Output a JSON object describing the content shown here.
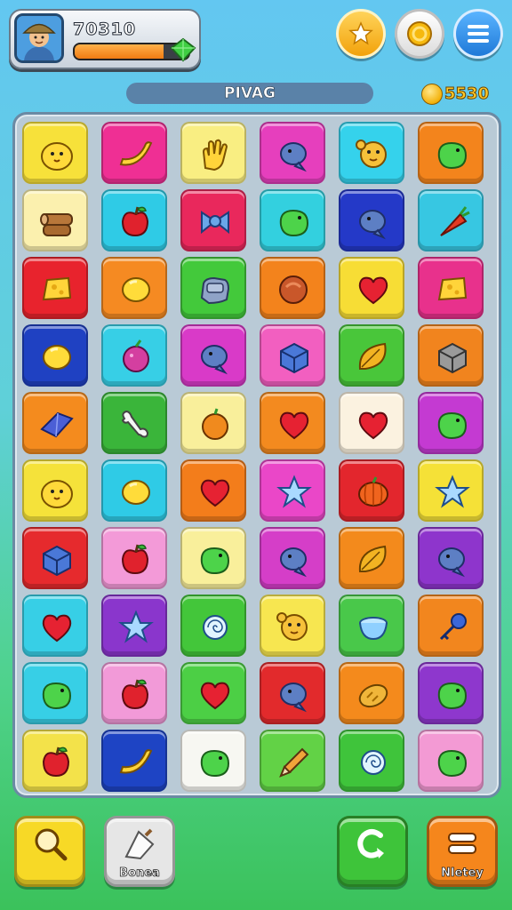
{
  "player": {
    "score": "70310",
    "xp_progress": 0.78,
    "avatar_icon": "explorer-avatar-icon",
    "gem_icon": "green-gem-icon"
  },
  "header_buttons": [
    {
      "name": "star-icon",
      "color": "#f6b51d"
    },
    {
      "name": "coin-icon",
      "color": "#f5f5f5"
    },
    {
      "name": "menu-icon",
      "color": "#2a8ee6"
    }
  ],
  "level": {
    "title": "PIVAG"
  },
  "coins": {
    "amount": "5530"
  },
  "grid": [
    [
      {
        "color": "#f7e13a",
        "icon": "chick"
      },
      {
        "color": "#ef2f94",
        "icon": "banana"
      },
      {
        "color": "#f9ee82",
        "icon": "glove"
      },
      {
        "color": "#e63fbd",
        "icon": "fish"
      },
      {
        "color": "#35d2ec",
        "icon": "flower"
      },
      {
        "color": "#f3841c",
        "icon": "blob"
      }
    ],
    [
      {
        "color": "#fbf0ae",
        "icon": "log"
      },
      {
        "color": "#2fcbe6",
        "icon": "apple"
      },
      {
        "color": "#e9285c",
        "icon": "bow"
      },
      {
        "color": "#33d0df",
        "icon": "blob"
      },
      {
        "color": "#2439c8",
        "icon": "fish"
      },
      {
        "color": "#37c7e2",
        "icon": "carrot"
      }
    ],
    [
      {
        "color": "#e8232d",
        "icon": "cheese"
      },
      {
        "color": "#f58a22",
        "icon": "lemon"
      },
      {
        "color": "#43c93b",
        "icon": "rock"
      },
      {
        "color": "#f3831c",
        "icon": "shell"
      },
      {
        "color": "#f7dd35",
        "icon": "heart"
      },
      {
        "color": "#e8318c",
        "icon": "cheese"
      }
    ],
    [
      {
        "color": "#1f41c2",
        "icon": "lemon"
      },
      {
        "color": "#37cfe6",
        "icon": "berry"
      },
      {
        "color": "#d93ac8",
        "icon": "fish"
      },
      {
        "color": "#f25fc0",
        "icon": "box"
      },
      {
        "color": "#49c63a",
        "icon": "leaf"
      },
      {
        "color": "#f1841e",
        "icon": "cube"
      }
    ],
    [
      {
        "color": "#f48b1e",
        "icon": "gem"
      },
      {
        "color": "#3ab53a",
        "icon": "bone"
      },
      {
        "color": "#f9ef9b",
        "icon": "orange"
      },
      {
        "color": "#f38a1f",
        "icon": "heart"
      },
      {
        "color": "#fbf2e0",
        "icon": "heart"
      },
      {
        "color": "#c43ad2",
        "icon": "blob"
      }
    ],
    [
      {
        "color": "#f5e23a",
        "icon": "chick"
      },
      {
        "color": "#2fcbe6",
        "icon": "lemon"
      },
      {
        "color": "#f37d1b",
        "icon": "heart"
      },
      {
        "color": "#ea47c8",
        "icon": "star"
      },
      {
        "color": "#e3262d",
        "icon": "pumpkin"
      },
      {
        "color": "#f5e137",
        "icon": "star"
      }
    ],
    [
      {
        "color": "#e62a2d",
        "icon": "box"
      },
      {
        "color": "#f39ad8",
        "icon": "apple"
      },
      {
        "color": "#f9ef9b",
        "icon": "blob"
      },
      {
        "color": "#d53ec8",
        "icon": "fish"
      },
      {
        "color": "#f38a1c",
        "icon": "leaf"
      },
      {
        "color": "#8e35cc",
        "icon": "fish"
      }
    ],
    [
      {
        "color": "#37cfe6",
        "icon": "heart"
      },
      {
        "color": "#8a36cc",
        "icon": "star"
      },
      {
        "color": "#43c63a",
        "icon": "candy"
      },
      {
        "color": "#f7e650",
        "icon": "flower"
      },
      {
        "color": "#49c84a",
        "icon": "bowl"
      },
      {
        "color": "#f2861e",
        "icon": "key"
      }
    ],
    [
      {
        "color": "#37cfe6",
        "icon": "blob"
      },
      {
        "color": "#f29ad8",
        "icon": "apple"
      },
      {
        "color": "#4ccf45",
        "icon": "heart"
      },
      {
        "color": "#e22a2c",
        "icon": "fish"
      },
      {
        "color": "#f48a1c",
        "icon": "bread"
      },
      {
        "color": "#8e37cd",
        "icon": "blob"
      }
    ],
    [
      {
        "color": "#f3e24a",
        "icon": "apple"
      },
      {
        "color": "#1e44c4",
        "icon": "banana"
      },
      {
        "color": "#f7f7f2",
        "icon": "blob"
      },
      {
        "color": "#62d246",
        "icon": "pencil"
      },
      {
        "color": "#3fc43b",
        "icon": "candy"
      },
      {
        "color": "#f39ad4",
        "icon": "blob"
      }
    ]
  ],
  "bottom_buttons": [
    {
      "name": "search-button",
      "label": "",
      "color": "#f7d926",
      "icon": "magnifier-icon"
    },
    {
      "name": "bonus-button",
      "label": "Bonea",
      "color": "#e6e6e6",
      "icon": "bucket-icon"
    },
    {
      "name": "refresh-button",
      "label": "",
      "color": "#3ec43a",
      "icon": "refresh-icon"
    },
    {
      "name": "history-button",
      "label": "Nletey",
      "color": "#f5861c",
      "icon": "pause-icon"
    }
  ]
}
